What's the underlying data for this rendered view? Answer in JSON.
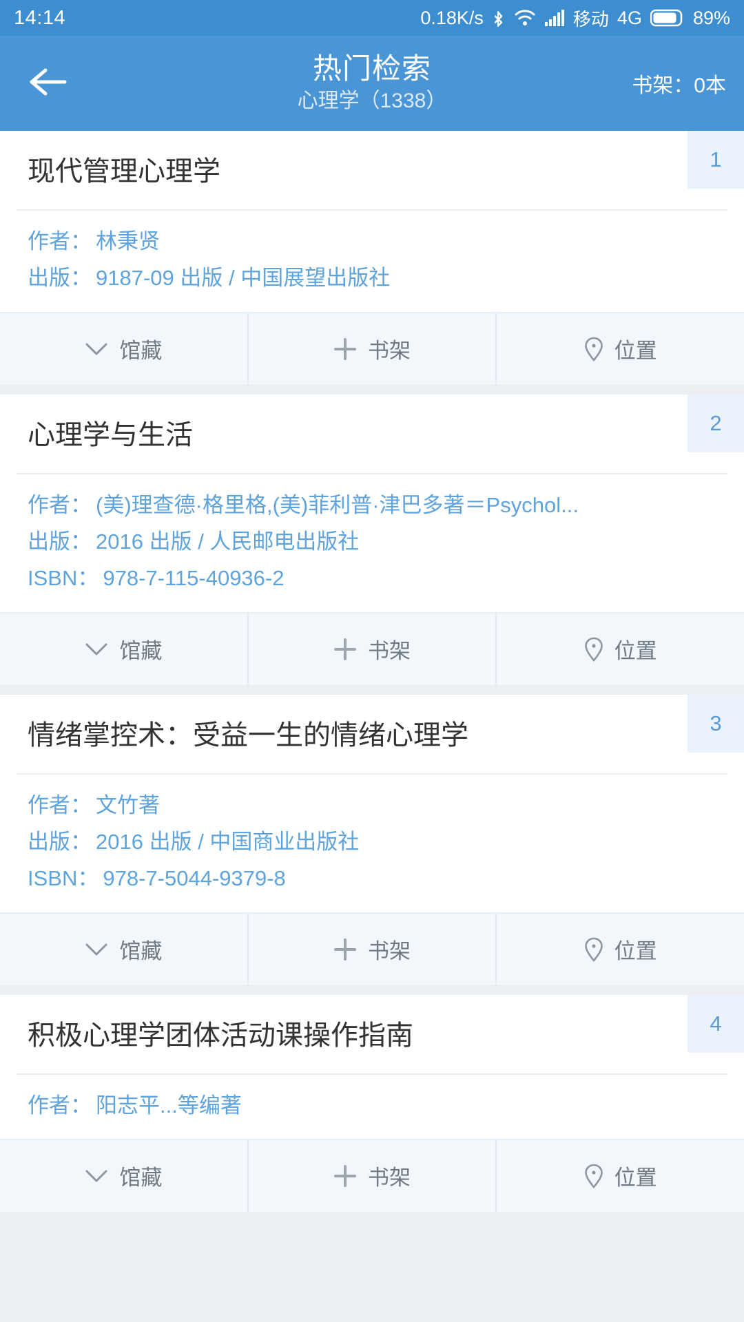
{
  "statusbar": {
    "time": "14:14",
    "network_speed": "0.18K/s",
    "bluetooth_icon": "bluetooth-icon",
    "wifi_icon": "wifi-icon",
    "signal_icon": "signal-bars-icon",
    "carrier": "移动",
    "network_type": "4G",
    "battery_icon": "battery-icon",
    "battery_percent": "89%"
  },
  "header": {
    "back_icon": "back-arrow-icon",
    "title": "热门检索",
    "subtitle": "心理学（1338）",
    "shelf_label": "书架：0本"
  },
  "actions": {
    "collection_label": "馆藏",
    "collection_icon": "chevron-down-icon",
    "shelf_label": "书架",
    "shelf_icon": "plus-icon",
    "location_label": "位置",
    "location_icon": "location-pin-icon"
  },
  "labels": {
    "author": "作者：",
    "publish": "出版：",
    "isbn": "ISBN："
  },
  "colors": {
    "primary": "#4a95d6",
    "statusbar": "#3d8ed1",
    "meta_text": "#5fa3dd",
    "badge_bg": "#eaf3fb",
    "badge_text": "#5b9ad5",
    "action_bg": "#f2f7fc",
    "action_text": "#6f7b84",
    "title_text": "#333333",
    "page_bg": "#eceff1"
  },
  "books": [
    {
      "rank": "1",
      "title": "现代管理心理学",
      "author": "林秉贤",
      "publish": "9187-09 出版 / 中国展望出版社",
      "isbn": ""
    },
    {
      "rank": "2",
      "title": "心理学与生活",
      "author": "(美)理查德·格里格,(美)菲利普·津巴多著＝Psychol...",
      "publish": "2016 出版 / 人民邮电出版社",
      "isbn": "978-7-115-40936-2"
    },
    {
      "rank": "3",
      "title": "情绪掌控术：受益一生的情绪心理学",
      "author": "文竹著",
      "publish": "2016 出版 / 中国商业出版社",
      "isbn": "978-7-5044-9379-8"
    },
    {
      "rank": "4",
      "title": "积极心理学团体活动课操作指南",
      "author": "阳志平...等编著",
      "publish": "",
      "isbn": ""
    }
  ]
}
